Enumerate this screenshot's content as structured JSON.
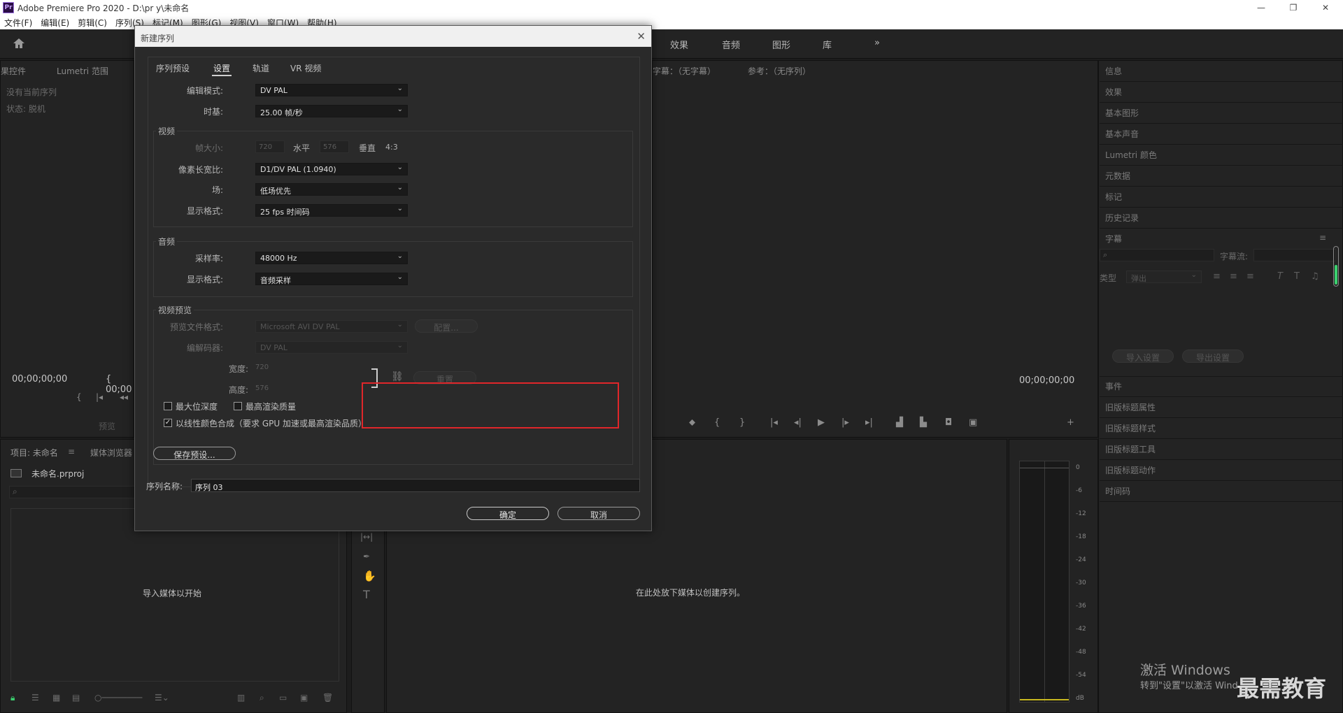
{
  "app": {
    "title": "Adobe Premiere Pro 2020 - D:\\pr y\\未命名",
    "icon_text": "Pr",
    "window_buttons": [
      "—",
      "❐",
      "✕"
    ]
  },
  "menu": [
    "文件(F)",
    "编辑(E)",
    "剪辑(C)",
    "序列(S)",
    "标记(M)",
    "图形(G)",
    "视图(V)",
    "窗口(W)",
    "帮助(H)"
  ],
  "workspaces": [
    "效果",
    "音频",
    "图形",
    "库",
    "»"
  ],
  "left_panel": {
    "tabs": [
      "果控件",
      "Lumetri 范围"
    ],
    "line1": "没有当前序列",
    "line2": "状态: 脱机",
    "timecode": "00;00;00;00",
    "timecode2": "{ 00;00",
    "preview_btn": "预览"
  },
  "program": {
    "tabs": [
      "字幕：（无字幕）",
      "参考：（无序列）"
    ],
    "timecode": "00;00;00;00"
  },
  "right_panel": {
    "items_top": [
      "信息",
      "效果",
      "基本图形",
      "基本声音",
      "Lumetri 颜色",
      "元数据",
      "标记",
      "历史记录"
    ],
    "caption_title": "字幕",
    "caption_stream_label": "字幕流:",
    "type_label": "类型",
    "type_value": "弹出",
    "import_btn": "导入设置",
    "export_btn": "导出设置",
    "items_bottom": [
      "事件",
      "旧版标题属性",
      "旧版标题样式",
      "旧版标题工具",
      "旧版标题动作",
      "时间码"
    ]
  },
  "project": {
    "tabs": [
      "项目: 未命名",
      "媒体浏览器"
    ],
    "file": "未命名.prproj",
    "empty": "导入媒体以开始"
  },
  "timeline": {
    "empty": "在此处放下媒体以创建序列。"
  },
  "meter": {
    "ticks": [
      "0",
      "-6",
      "-12",
      "-18",
      "-24",
      "-30",
      "-36",
      "-42",
      "-48",
      "-54",
      "dB"
    ]
  },
  "watermark": {
    "line1": "激活 Windows",
    "line2": "转到\"设置\"以激活 Windows。",
    "brand": "最需教育"
  },
  "dialog": {
    "title": "新建序列",
    "tabs": [
      "序列预设",
      "设置",
      "轨道",
      "VR 视频"
    ],
    "edit_mode_label": "编辑模式:",
    "edit_mode": "DV PAL",
    "timebase_label": "时基:",
    "timebase": "25.00  帧/秒",
    "video_group": "视频",
    "frame_size_label": "帧大小:",
    "frame_w": "720",
    "horizontal": "水平",
    "frame_h": "576",
    "vertical": "垂直",
    "ratio": "4:3",
    "par_label": "像素长宽比:",
    "par": "D1/DV PAL (1.0940)",
    "field_label": "场:",
    "field": "低场优先",
    "vdisplay_label": "显示格式:",
    "vdisplay": "25 fps 时间码",
    "audio_group": "音频",
    "samplerate_label": "采样率:",
    "samplerate": "48000 Hz",
    "adisplay_label": "显示格式:",
    "adisplay": "音频采样",
    "preview_group": "视频预览",
    "pff_label": "预览文件格式:",
    "pff": "Microsoft AVI DV PAL",
    "config_btn": "配置...",
    "codec_label": "编解码器:",
    "codec": "DV PAL",
    "width_label": "宽度:",
    "width": "720",
    "height_label": "高度:",
    "height": "576",
    "reset_btn": "重置",
    "max_depth": "最大位深度",
    "max_quality": "最高渲染质量",
    "linear_color": "以线性颜色合成（要求 GPU 加速或最高渲染品质）",
    "save_preset": "保存预设...",
    "seq_name_label": "序列名称:",
    "seq_name": "序列 03",
    "ok": "确定",
    "cancel": "取消"
  }
}
